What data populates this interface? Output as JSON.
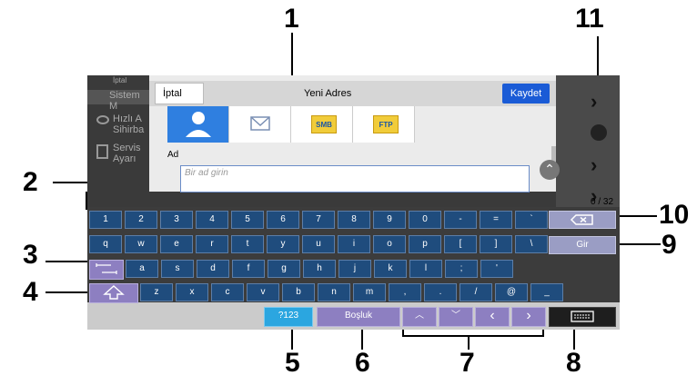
{
  "sidebar": {
    "items": [
      {
        "label": "İptal"
      },
      {
        "label": "Sistem M"
      },
      {
        "label": "Hızlı A",
        "sub": "Sihirba"
      },
      {
        "label": "Servis",
        "sub": "Ayarı"
      }
    ]
  },
  "dialog": {
    "cancel_label": "İptal",
    "title": "Yeni Adres",
    "save_label": "Kaydet",
    "tabs": [
      {
        "icon": "person-icon",
        "selected": true
      },
      {
        "icon": "envelope-icon",
        "selected": false
      },
      {
        "label": "SMB"
      },
      {
        "label": "FTP"
      }
    ],
    "field_label": "Ad",
    "field_placeholder": "Bir ad girin",
    "char_counter": "0 / 32"
  },
  "keyboard": {
    "row1": [
      "1",
      "2",
      "3",
      "4",
      "5",
      "6",
      "7",
      "8",
      "9",
      "0",
      "-",
      "=",
      "`"
    ],
    "row2": [
      "q",
      "w",
      "e",
      "r",
      "t",
      "y",
      "u",
      "i",
      "o",
      "p",
      "[",
      "]",
      "\\"
    ],
    "row3": [
      "a",
      "s",
      "d",
      "f",
      "g",
      "h",
      "j",
      "k",
      "l",
      ";",
      "'"
    ],
    "row4": [
      "z",
      "x",
      "c",
      "v",
      "b",
      "n",
      "m",
      ",",
      ".",
      "/",
      "@",
      "_"
    ],
    "enter_label": "Gir",
    "symbols_label": "?123",
    "space_label": "Boşluk"
  },
  "callouts": [
    "1",
    "2",
    "3",
    "4",
    "5",
    "6",
    "7",
    "8",
    "9",
    "10",
    "11"
  ],
  "colors": {
    "save": "#1a5bd6",
    "key": "#1f4c7d",
    "symbols": "#2ba6e0"
  }
}
